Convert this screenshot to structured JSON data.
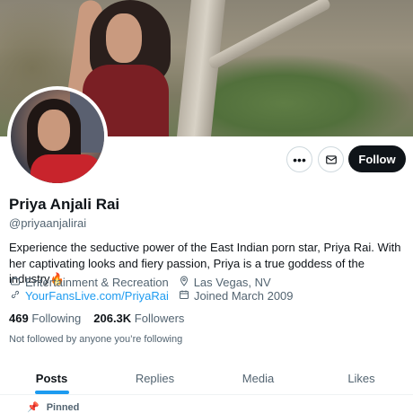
{
  "profile": {
    "name": "Priya Anjali Rai",
    "handle": "@priyaanjalirai",
    "bio": "Experience the seductive power of the East Indian porn star, Priya Rai. With her captivating looks and fiery passion, Priya is a true goddess of the industry🔥",
    "category": "Entertainment & Recreation",
    "location": "Las Vegas, NV",
    "website": "YourFansLive.com/PriyaRai",
    "joined": "Joined March 2009",
    "following_count": "469",
    "following_label": "Following",
    "followers_count": "206.3K",
    "followers_label": "Followers",
    "not_followed_text": "Not followed by anyone you’re following"
  },
  "actions": {
    "more_icon": "more-dots-icon",
    "message_icon": "mail-icon",
    "follow_label": "Follow"
  },
  "tabs": [
    {
      "label": "Posts",
      "active": true
    },
    {
      "label": "Replies",
      "active": false
    },
    {
      "label": "Media",
      "active": false
    },
    {
      "label": "Likes",
      "active": false
    }
  ],
  "pinned_label": "Pinned",
  "colors": {
    "accent": "#1d9bf0",
    "text": "#0f1419",
    "secondary": "#536471",
    "follow_bg": "#0f1419"
  }
}
